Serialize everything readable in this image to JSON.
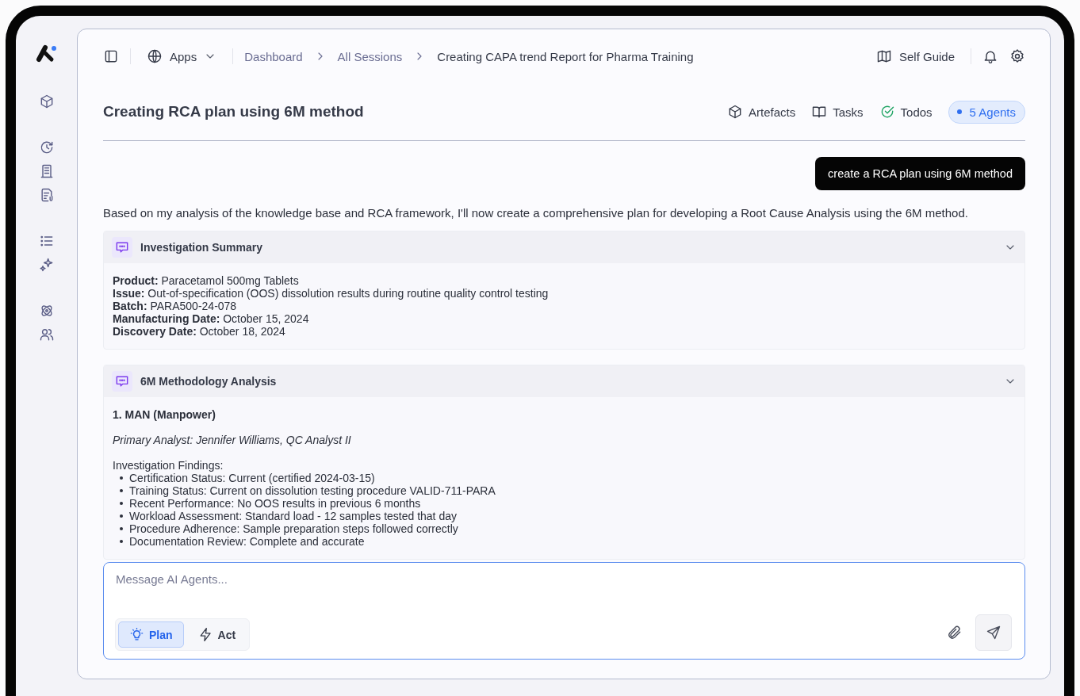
{
  "topbar": {
    "apps_menu": {
      "label": "Apps"
    },
    "breadcrumbs": [
      {
        "label": "Dashboard",
        "current": false
      },
      {
        "label": "All Sessions",
        "current": false
      },
      {
        "label": "Creating CAPA trend Report for Pharma Training",
        "current": true
      }
    ],
    "self_guide": {
      "label": "Self Guide"
    }
  },
  "title": "Creating RCA plan using 6M method",
  "toolbar": [
    {
      "kind": "artefacts",
      "label": "Artefacts"
    },
    {
      "kind": "tasks",
      "label": "Tasks"
    },
    {
      "kind": "todos",
      "label": "Todos"
    },
    {
      "kind": "agents",
      "label": "5 Agents"
    }
  ],
  "messages": [
    {
      "kind": "user",
      "text": "create a RCA plan using 6M method"
    },
    {
      "kind": "assistant",
      "text": "Based on my analysis of the knowledge base and RCA framework, I'll now create a comprehensive plan for developing a  Root Cause Analysis using the 6M method."
    }
  ],
  "cards": [
    {
      "title": "Investigation Summary",
      "expanded": true,
      "blocks": [
        {
          "kind": "line",
          "text": "**Product:** Paracetamol 500mg Tablets"
        },
        {
          "kind": "line",
          "text": "**Issue:** Out-of-specification (OOS) dissolution results during routine quality control testing"
        },
        {
          "kind": "line",
          "text": "**Batch:** PARA500-24-078"
        },
        {
          "kind": "line",
          "text": "**Manufacturing Date:** October 15, 2024"
        },
        {
          "kind": "line",
          "text": "**Discovery Date:** October 18, 2024"
        }
      ]
    },
    {
      "title": "6M Methodology Analysis",
      "expanded": true,
      "blocks": [
        {
          "kind": "heading",
          "text": "1. MAN (Manpower)"
        },
        {
          "kind": "note",
          "text": "Primary Analyst: Jennifer Williams, QC Analyst II"
        },
        {
          "kind": "label",
          "text": "Investigation Findings:"
        },
        {
          "kind": "list",
          "items": [
            "Certification Status: Current (certified 2024-03-15)",
            "Training Status: Current on dissolution testing procedure VALID-711-PARA",
            "Recent Performance: No OOS results in previous 6 months",
            "Workload Assessment: Standard load - 12 samples tested that day",
            "Procedure Adherence: Sample preparation steps followed correctly",
            "Documentation Review: Complete and accurate"
          ]
        }
      ]
    }
  ],
  "composer": {
    "placeholder": "Message AI Agents...",
    "modes": [
      {
        "kind": "plan",
        "label": "Plan",
        "selected": true
      },
      {
        "kind": "act",
        "label": "Act",
        "selected": false
      }
    ]
  }
}
